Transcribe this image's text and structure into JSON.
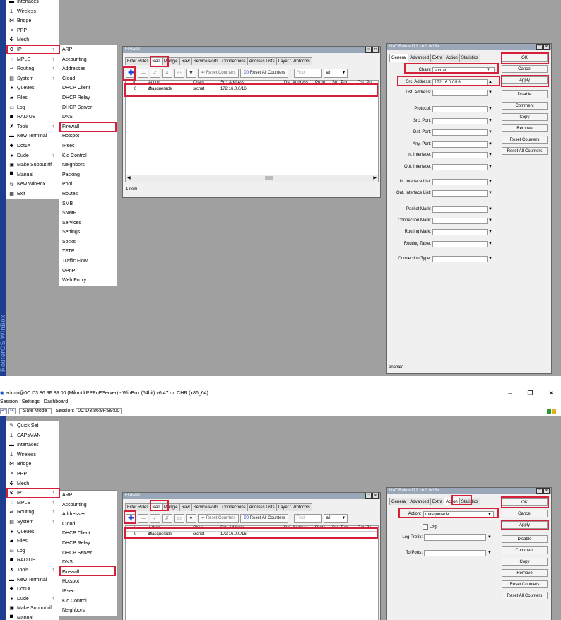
{
  "brand_text": "RouterOS WinBox",
  "app": {
    "title": "admin@0C:D3:86:9F:89:00 (MikrotikPPPoEServer) - WinBox (64bit) v6.47 on CHR (x86_64)",
    "menu": [
      "Session",
      "Settings",
      "Dashboard"
    ],
    "safe_mode": "Safe Mode",
    "session_label": "Session:",
    "session_value": "0C:D3:86:9F:89:00",
    "win_min": "–",
    "win_max": "❐",
    "win_close": "✕"
  },
  "sidebar_top": [
    {
      "icon": "▬",
      "label": "Interfaces"
    },
    {
      "icon": "⊥",
      "label": "Wireless"
    },
    {
      "icon": "⋈",
      "label": "Bridge"
    },
    {
      "icon": "≡",
      "label": "PPP"
    },
    {
      "icon": "✣",
      "label": "Mesh"
    },
    {
      "icon": "⚙",
      "label": "IP",
      "arrow": "↑"
    },
    {
      "icon": "◌",
      "label": "MPLS",
      "arrow": "↑"
    },
    {
      "icon": "⇌",
      "label": "Routing",
      "arrow": "↑"
    },
    {
      "icon": "▤",
      "label": "System",
      "arrow": "↑"
    },
    {
      "icon": "●",
      "label": "Queues"
    },
    {
      "icon": "▰",
      "label": "Files"
    },
    {
      "icon": "▭",
      "label": "Log"
    },
    {
      "icon": "☗",
      "label": "RADIUS"
    },
    {
      "icon": "✗",
      "label": "Tools",
      "arrow": "↑"
    },
    {
      "icon": "▬",
      "label": "New Terminal"
    },
    {
      "icon": "✚",
      "label": "Dot1X"
    },
    {
      "icon": "●",
      "label": "Dude",
      "arrow": "↑"
    },
    {
      "icon": "▣",
      "label": "Make Supout.rif"
    },
    {
      "icon": "▀",
      "label": "Manual"
    },
    {
      "icon": "◎",
      "label": "New WinBox"
    },
    {
      "icon": "▦",
      "label": "Exit"
    }
  ],
  "sidebar_bottom": [
    {
      "icon": "✎",
      "label": "Quick Set"
    },
    {
      "icon": "⊥",
      "label": "CAPsMAN"
    },
    {
      "icon": "▬",
      "label": "Interfaces"
    },
    {
      "icon": "⊥",
      "label": "Wireless"
    },
    {
      "icon": "⋈",
      "label": "Bridge"
    },
    {
      "icon": "≡",
      "label": "PPP"
    },
    {
      "icon": "✣",
      "label": "Mesh"
    },
    {
      "icon": "⚙",
      "label": "IP",
      "arrow": "↑"
    },
    {
      "icon": "◌",
      "label": "MPLS",
      "arrow": "↑"
    },
    {
      "icon": "⇌",
      "label": "Routing",
      "arrow": "↑"
    },
    {
      "icon": "▤",
      "label": "System",
      "arrow": "↑"
    },
    {
      "icon": "●",
      "label": "Queues"
    },
    {
      "icon": "▰",
      "label": "Files"
    },
    {
      "icon": "▭",
      "label": "Log"
    },
    {
      "icon": "☗",
      "label": "RADIUS"
    },
    {
      "icon": "✗",
      "label": "Tools",
      "arrow": "↑"
    },
    {
      "icon": "▬",
      "label": "New Terminal"
    },
    {
      "icon": "✚",
      "label": "Dot1X"
    },
    {
      "icon": "●",
      "label": "Dude",
      "arrow": "↑"
    },
    {
      "icon": "▣",
      "label": "Make Supout.rif"
    },
    {
      "icon": "▀",
      "label": "Manual"
    }
  ],
  "ip_submenu": [
    "ARP",
    "Accounting",
    "Addresses",
    "Cloud",
    "DHCP Client",
    "DHCP Relay",
    "DHCP Server",
    "DNS",
    "Firewall",
    "Hotspot",
    "IPsec",
    "Kid Control",
    "Neighbors",
    "Packing",
    "Pool",
    "Routes",
    "SMB",
    "SNMP",
    "Services",
    "Settings",
    "Socks",
    "TFTP",
    "Traffic Flow",
    "UPnP",
    "Web Proxy"
  ],
  "firewall": {
    "title": "Firewall",
    "tabs": [
      "Filter Rules",
      "NAT",
      "Mangle",
      "Raw",
      "Service Ports",
      "Connections",
      "Address Lists",
      "Layer7 Protocols"
    ],
    "reset_counters": "Reset Counters",
    "reset_all_counters": "Reset All Counters",
    "find_placeholder": "Find",
    "filter_value": "all",
    "columns": [
      "#",
      "Action",
      "Chain",
      "Src. Address",
      "Dst. Address",
      "Proto...",
      "Src. Port",
      "Dst. Po..."
    ],
    "row": {
      "num": "0",
      "action": "masquerade",
      "chain": "srcnat",
      "src": "172.16.0.0/16"
    },
    "status": "1 item"
  },
  "nat_rule": {
    "title": "NAT Rule <172.16.0.0/16>",
    "tabs": [
      "General",
      "Advanced",
      "Extra",
      "Action",
      "Statistics"
    ],
    "general_fields": [
      {
        "label": "Chain:",
        "value": "srcnat"
      },
      {
        "label": "Src. Address:",
        "value": "172.16.0.0/16"
      },
      {
        "label": "Dst. Address:",
        "value": ""
      },
      {
        "label": "Protocol:",
        "value": ""
      },
      {
        "label": "Src. Port:",
        "value": ""
      },
      {
        "label": "Dst. Port:",
        "value": ""
      },
      {
        "label": "Any. Port:",
        "value": ""
      },
      {
        "label": "In. Interface:",
        "value": ""
      },
      {
        "label": "Out. Interface:",
        "value": ""
      },
      {
        "label": "In. Interface List:",
        "value": ""
      },
      {
        "label": "Out. Interface List:",
        "value": ""
      },
      {
        "label": "Packet Mark:",
        "value": ""
      },
      {
        "label": "Connection Mark:",
        "value": ""
      },
      {
        "label": "Routing Mark:",
        "value": ""
      },
      {
        "label": "Routing Table:",
        "value": ""
      },
      {
        "label": "Connection Type:",
        "value": ""
      }
    ],
    "action_label": "Action:",
    "action_value": "masquerade",
    "log_label": "Log",
    "log_prefix_label": "Log Prefix:",
    "to_ports_label": "To Ports:",
    "buttons": [
      "OK",
      "Cancel",
      "Apply",
      "Disable",
      "Comment",
      "Copy",
      "Remove",
      "Reset Counters",
      "Reset All Counters"
    ],
    "status": "enabled"
  }
}
